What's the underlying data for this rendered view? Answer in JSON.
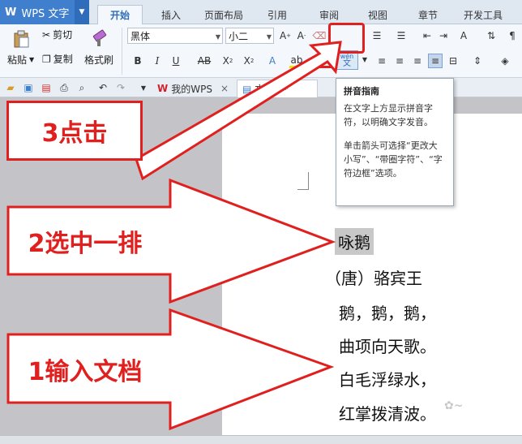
{
  "app": {
    "name": "WPS 文字"
  },
  "tabs": [
    "开始",
    "插入",
    "页面布局",
    "引用",
    "审阅",
    "视图",
    "章节",
    "开发工具"
  ],
  "ribbon": {
    "paste_label": "粘贴",
    "cut_label": "剪切",
    "copy_label": "复制",
    "format_painter_label": "格式刷",
    "font_family": "黑体",
    "font_size": "小二",
    "pinyin_top": "wén",
    "pinyin_bottom": "文"
  },
  "doc_tabs": [
    {
      "label": "我的WPS"
    },
    {
      "label": "文档1 *"
    }
  ],
  "tooltip": {
    "title": "拼音指南",
    "body1": "在文字上方显示拼音字符，以明确文字发音。",
    "body2": "单击箭头可选择“更改大小写”、“带圈字符”、“字符边框”选项。"
  },
  "document": {
    "lines": [
      "咏鹅",
      "（唐）骆宾王",
      "鹅，鹅，鹅，",
      "曲项向天歌。",
      "白毛浮绿水，",
      "红掌拨清波。"
    ]
  },
  "annotations": {
    "step3": "3点击",
    "step2": "2选中一排",
    "step1": "1输入文档",
    "color": "#e0201f"
  }
}
